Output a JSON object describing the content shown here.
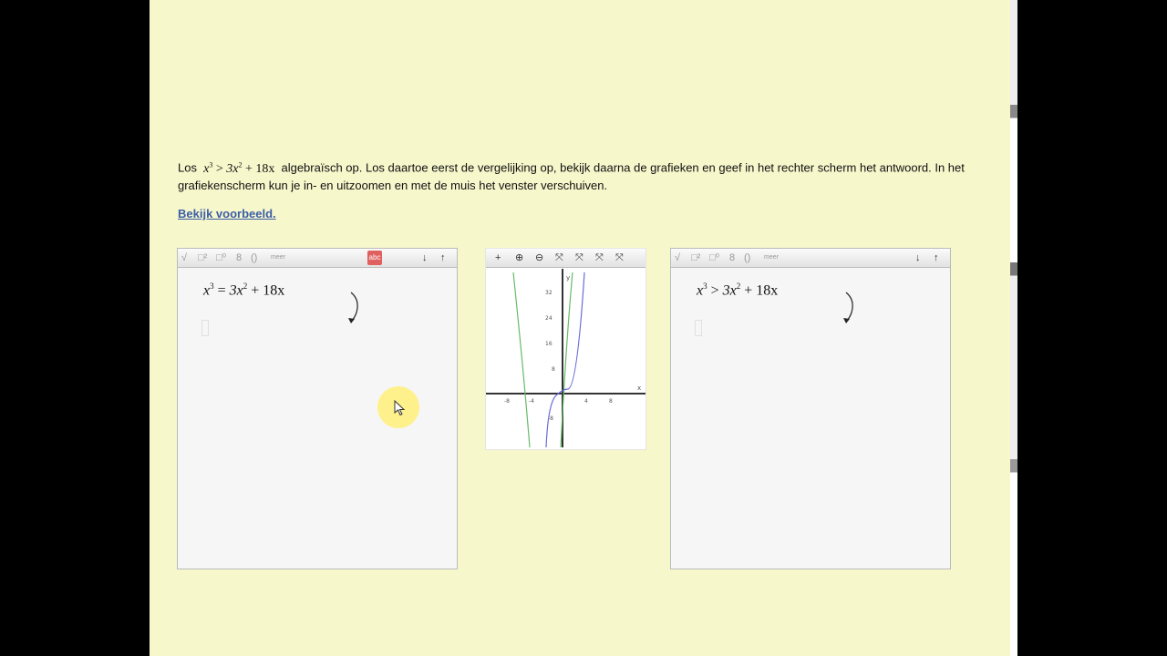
{
  "instruction": {
    "prefix": "Los",
    "inequality": {
      "x": "x",
      "exp": "3",
      "op": ">",
      "coef": "3x",
      "exp2": "2",
      "rest": "+ 18x"
    },
    "suffix": "algebraïsch op. Los daartoe eerst de vergelijking op, bekijk daarna de grafieken en geef in het rechter scherm het antwoord. In het grafiekenscherm kun je in- en uitzoomen en met de muis het venster verschuiven."
  },
  "link": "Bekijk voorbeeld.",
  "left_panel": {
    "toolbar": [
      "√",
      "□²",
      "□⁰",
      "8",
      "()",
      "meer",
      "abc",
      "↓",
      "↑"
    ],
    "equation": {
      "lhs": "x",
      "lhs_exp": "3",
      "op": "=",
      "c": "3x",
      "c_exp": "2",
      "rest": "+ 18x"
    }
  },
  "graph_panel": {
    "toolbar": [
      "+",
      "⊕",
      "⊖",
      "⤧",
      "⤧",
      "⤧",
      "⤧"
    ],
    "x_ticks": [
      "-8",
      "-4",
      "4",
      "8"
    ],
    "y_ticks": [
      "32",
      "24",
      "16",
      "8",
      "-8"
    ],
    "x_label": "x",
    "y_label": "y",
    "colors": {
      "cubic": "#6a6ad8",
      "quadratic": "#66bb66",
      "axes": "#333333"
    }
  },
  "right_panel": {
    "toolbar": [
      "√",
      "□²",
      "□⁰",
      "8",
      "()",
      "meer",
      "↓",
      "↑"
    ],
    "equation": {
      "lhs": "x",
      "lhs_exp": "3",
      "op": ">",
      "c": "3x",
      "c_exp": "2",
      "rest": "+ 18x"
    }
  }
}
